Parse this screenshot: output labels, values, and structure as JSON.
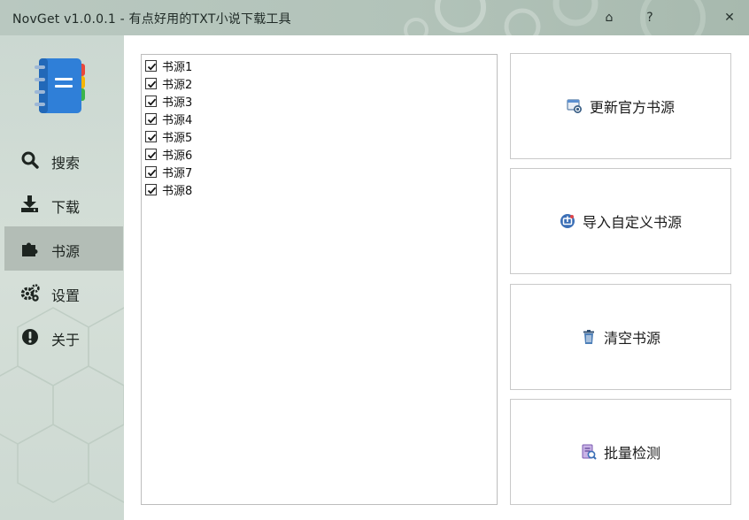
{
  "window": {
    "title": "NovGet v1.0.0.1 - 有点好用的TXT小说下载工具",
    "home_symbol": "⌂",
    "help_symbol": "?",
    "close_symbol": "✕"
  },
  "sidebar": {
    "items": [
      {
        "label": "搜索",
        "icon": "search-icon",
        "active": false
      },
      {
        "label": "下载",
        "icon": "download-icon",
        "active": false
      },
      {
        "label": "书源",
        "icon": "puzzle-icon",
        "active": true
      },
      {
        "label": "设置",
        "icon": "gears-icon",
        "active": false
      },
      {
        "label": "关于",
        "icon": "info-icon",
        "active": false
      }
    ]
  },
  "sources": [
    {
      "label": "书源1",
      "checked": true
    },
    {
      "label": "书源2",
      "checked": true
    },
    {
      "label": "书源3",
      "checked": true
    },
    {
      "label": "书源4",
      "checked": true
    },
    {
      "label": "书源5",
      "checked": true
    },
    {
      "label": "书源6",
      "checked": true
    },
    {
      "label": "书源7",
      "checked": true
    },
    {
      "label": "书源8",
      "checked": true
    }
  ],
  "actions": {
    "update": "更新官方书源",
    "import": "导入自定义书源",
    "clear": "清空书源",
    "check": "批量检测"
  },
  "colors": {
    "accent_blue": "#2f7fd8",
    "active_nav": "#b3bdb6"
  }
}
